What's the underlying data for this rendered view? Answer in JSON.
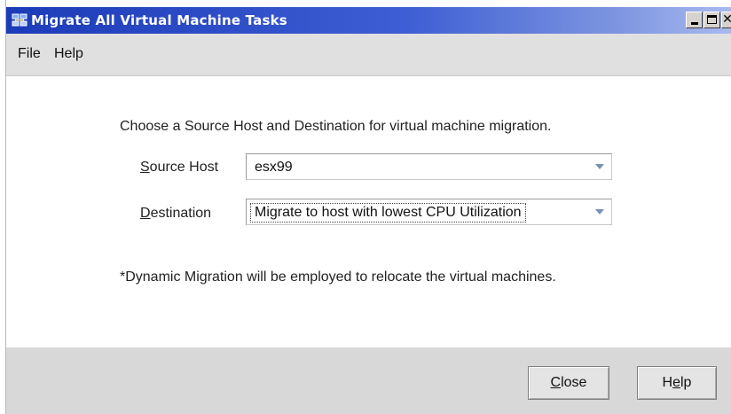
{
  "window": {
    "title": "Migrate All Virtual Machine Tasks",
    "icon": "vm-tasks-icon",
    "controls": [
      "minimize",
      "maximize",
      "close"
    ]
  },
  "menu": {
    "file": "File",
    "help": "Help"
  },
  "main": {
    "instruction": "Choose a Source Host and Destination for virtual machine migration.",
    "source_host": {
      "label_mnemonic": "S",
      "label_rest": "ource Host",
      "value": "esx99"
    },
    "destination": {
      "label_mnemonic": "D",
      "label_rest": "estination",
      "value": "Migrate to host with lowest CPU Utilization"
    },
    "note": "*Dynamic Migration will be employed to relocate the virtual machines."
  },
  "footer": {
    "close_mnemonic": "C",
    "close_rest": "lose",
    "help_prefix": "H",
    "help_mnemonic": "e",
    "help_rest": "lp"
  },
  "colors": {
    "titlebar_start": "#1c3bb8",
    "titlebar_end": "#a9baf0",
    "menubar": "#e0e0e0",
    "footer": "#d8d8d8",
    "combo_arrow": "#7a8fb8"
  }
}
